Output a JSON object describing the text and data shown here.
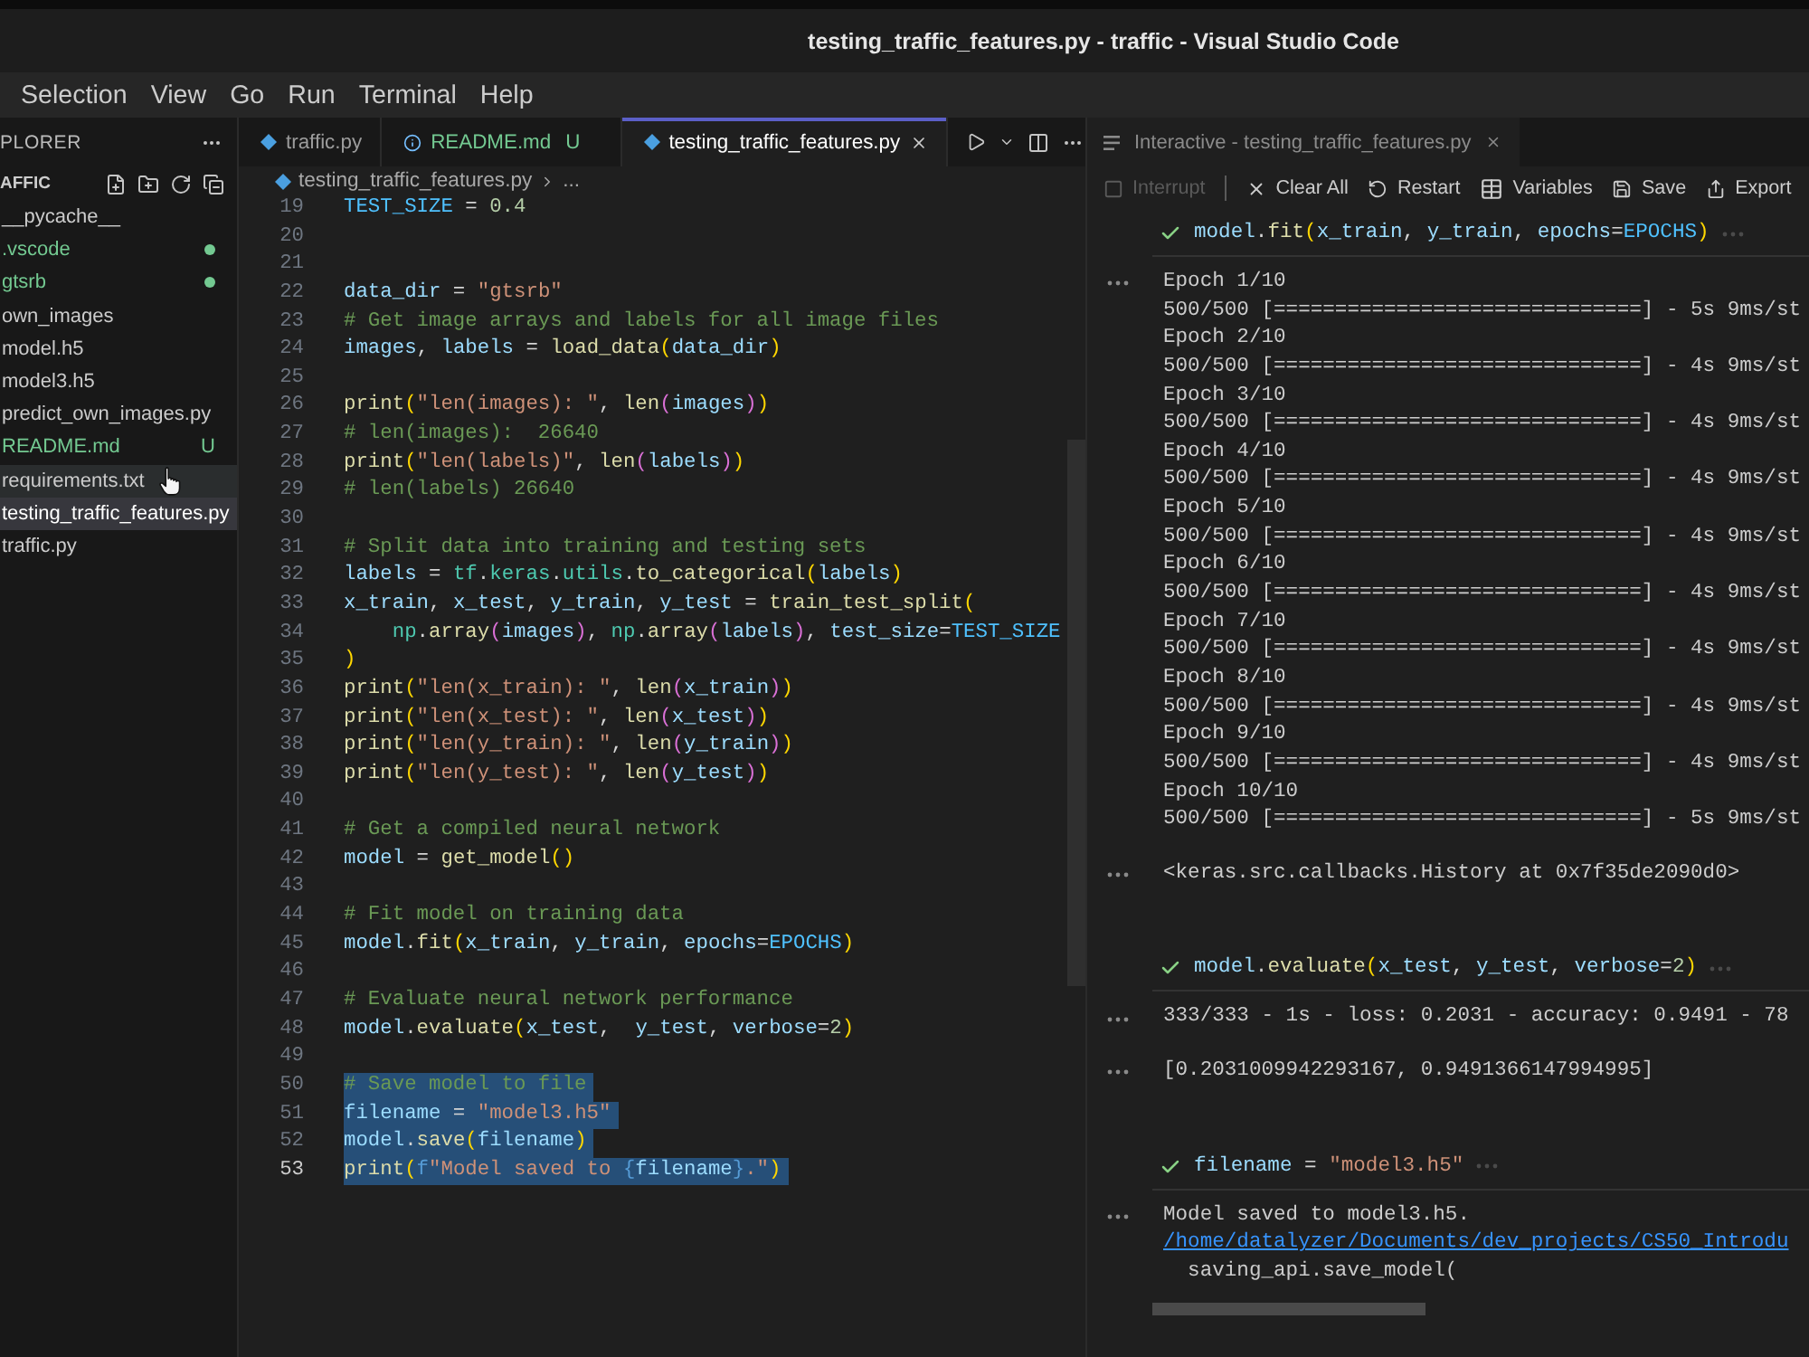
{
  "window": {
    "title": "testing_traffic_features.py - traffic - Visual Studio Code"
  },
  "menu": [
    "Selection",
    "View",
    "Go",
    "Run",
    "Terminal",
    "Help"
  ],
  "sidebar": {
    "title": "PLORER",
    "folder": "AFFIC",
    "files": [
      {
        "name": "__pycache__",
        "untracked": false,
        "selected": false,
        "hovered": false
      },
      {
        "name": ".vscode",
        "untracked": true,
        "selected": false,
        "hovered": false,
        "decoration": {
          "kind": "dot"
        }
      },
      {
        "name": "gtsrb",
        "untracked": true,
        "selected": false,
        "hovered": false,
        "decoration": {
          "kind": "dot"
        }
      },
      {
        "name": "own_images",
        "untracked": false,
        "selected": false,
        "hovered": false
      },
      {
        "name": "model.h5",
        "untracked": false,
        "selected": false,
        "hovered": false
      },
      {
        "name": "model3.h5",
        "untracked": false,
        "selected": false,
        "hovered": false
      },
      {
        "name": "predict_own_images.py",
        "untracked": false,
        "selected": false,
        "hovered": false
      },
      {
        "name": "README.md",
        "untracked": true,
        "selected": false,
        "hovered": false,
        "decoration": {
          "kind": "letter",
          "text": "U"
        }
      },
      {
        "name": "requirements.txt",
        "untracked": false,
        "selected": false,
        "hovered": true
      },
      {
        "name": "testing_traffic_features.py",
        "untracked": false,
        "selected": true,
        "hovered": false
      },
      {
        "name": "traffic.py",
        "untracked": false,
        "selected": false,
        "hovered": false
      }
    ]
  },
  "editor": {
    "tabs": [
      {
        "label": "traffic.py",
        "kind": "python",
        "untracked": false,
        "selected": false
      },
      {
        "label": "README.md",
        "kind": "info",
        "untracked": true,
        "badge": "U",
        "selected": false
      },
      {
        "label": "testing_traffic_features.py",
        "kind": "python",
        "untracked": false,
        "selected": true
      }
    ],
    "breadcrumb": [
      "testing_traffic_features.py",
      "..."
    ],
    "lines": [
      {
        "number": "19",
        "current": false,
        "tokens": [
          {
            "text": "TEST_SIZE",
            "kind": "const"
          },
          {
            "text": " = ",
            "kind": "plain"
          },
          {
            "text": "0.4",
            "kind": "num"
          }
        ]
      },
      {
        "number": "20",
        "current": false
      },
      {
        "number": "21",
        "current": false
      },
      {
        "number": "22",
        "current": false,
        "tokens": [
          {
            "text": "data_dir",
            "kind": "var"
          },
          {
            "text": " = ",
            "kind": "plain"
          },
          {
            "text": "\"gtsrb\"",
            "kind": "str"
          }
        ]
      },
      {
        "number": "23",
        "current": false,
        "tokens": [
          {
            "text": "# Get image arrays and labels for all image files",
            "kind": "comment"
          }
        ]
      },
      {
        "number": "24",
        "current": false,
        "tokens": [
          {
            "text": "images",
            "kind": "var"
          },
          {
            "text": ", ",
            "kind": "plain"
          },
          {
            "text": "labels",
            "kind": "var"
          },
          {
            "text": " = ",
            "kind": "plain"
          },
          {
            "text": "load_data",
            "kind": "func"
          },
          {
            "text": "(",
            "kind": "bracket1"
          },
          {
            "text": "data_dir",
            "kind": "var"
          },
          {
            "text": ")",
            "kind": "bracket1"
          }
        ]
      },
      {
        "number": "25",
        "current": false
      },
      {
        "number": "26",
        "current": false,
        "tokens": [
          {
            "text": "print",
            "kind": "func"
          },
          {
            "text": "(",
            "kind": "bracket1"
          },
          {
            "text": "\"len(images): \"",
            "kind": "str"
          },
          {
            "text": ", ",
            "kind": "plain"
          },
          {
            "text": "len",
            "kind": "func"
          },
          {
            "text": "(",
            "kind": "bracket2"
          },
          {
            "text": "images",
            "kind": "var"
          },
          {
            "text": ")",
            "kind": "bracket2"
          },
          {
            "text": ")",
            "kind": "bracket1"
          }
        ]
      },
      {
        "number": "27",
        "current": false,
        "tokens": [
          {
            "text": "# len(images):  26640",
            "kind": "comment"
          }
        ]
      },
      {
        "number": "28",
        "current": false,
        "tokens": [
          {
            "text": "print",
            "kind": "func"
          },
          {
            "text": "(",
            "kind": "bracket1"
          },
          {
            "text": "\"len(labels)\"",
            "kind": "str"
          },
          {
            "text": ", ",
            "kind": "plain"
          },
          {
            "text": "len",
            "kind": "func"
          },
          {
            "text": "(",
            "kind": "bracket2"
          },
          {
            "text": "labels",
            "kind": "var"
          },
          {
            "text": ")",
            "kind": "bracket2"
          },
          {
            "text": ")",
            "kind": "bracket1"
          }
        ]
      },
      {
        "number": "29",
        "current": false,
        "tokens": [
          {
            "text": "# len(labels) 26640",
            "kind": "comment"
          }
        ]
      },
      {
        "number": "30",
        "current": false
      },
      {
        "number": "31",
        "current": false,
        "tokens": [
          {
            "text": "# Split data into training and testing sets",
            "kind": "comment"
          }
        ]
      },
      {
        "number": "32",
        "current": false,
        "tokens": [
          {
            "text": "labels",
            "kind": "var"
          },
          {
            "text": " = ",
            "kind": "plain"
          },
          {
            "text": "tf",
            "kind": "module"
          },
          {
            "text": ".",
            "kind": "plain"
          },
          {
            "text": "keras",
            "kind": "module"
          },
          {
            "text": ".",
            "kind": "plain"
          },
          {
            "text": "utils",
            "kind": "module"
          },
          {
            "text": ".",
            "kind": "plain"
          },
          {
            "text": "to_categorical",
            "kind": "func"
          },
          {
            "text": "(",
            "kind": "bracket1"
          },
          {
            "text": "labels",
            "kind": "var"
          },
          {
            "text": ")",
            "kind": "bracket1"
          }
        ]
      },
      {
        "number": "33",
        "current": false,
        "tokens": [
          {
            "text": "x_train",
            "kind": "var"
          },
          {
            "text": ", ",
            "kind": "plain"
          },
          {
            "text": "x_test",
            "kind": "var"
          },
          {
            "text": ", ",
            "kind": "plain"
          },
          {
            "text": "y_train",
            "kind": "var"
          },
          {
            "text": ", ",
            "kind": "plain"
          },
          {
            "text": "y_test",
            "kind": "var"
          },
          {
            "text": " = ",
            "kind": "plain"
          },
          {
            "text": "train_test_split",
            "kind": "func"
          },
          {
            "text": "(",
            "kind": "bracket1"
          }
        ]
      },
      {
        "number": "34",
        "current": false,
        "tokens": [
          {
            "text": "    np",
            "kind": "module"
          },
          {
            "text": ".",
            "kind": "plain"
          },
          {
            "text": "array",
            "kind": "func"
          },
          {
            "text": "(",
            "kind": "bracket2"
          },
          {
            "text": "images",
            "kind": "var"
          },
          {
            "text": ")",
            "kind": "bracket2"
          },
          {
            "text": ", ",
            "kind": "plain"
          },
          {
            "text": "np",
            "kind": "module"
          },
          {
            "text": ".",
            "kind": "plain"
          },
          {
            "text": "array",
            "kind": "func"
          },
          {
            "text": "(",
            "kind": "bracket2"
          },
          {
            "text": "labels",
            "kind": "var"
          },
          {
            "text": ")",
            "kind": "bracket2"
          },
          {
            "text": ", ",
            "kind": "plain"
          },
          {
            "text": "test_size",
            "kind": "var"
          },
          {
            "text": "=",
            "kind": "plain"
          },
          {
            "text": "TEST_SIZE",
            "kind": "const"
          }
        ]
      },
      {
        "number": "35",
        "current": false,
        "tokens": [
          {
            "text": ")",
            "kind": "bracket1"
          }
        ]
      },
      {
        "number": "36",
        "current": false,
        "tokens": [
          {
            "text": "print",
            "kind": "func"
          },
          {
            "text": "(",
            "kind": "bracket1"
          },
          {
            "text": "\"len(x_train): \"",
            "kind": "str"
          },
          {
            "text": ", ",
            "kind": "plain"
          },
          {
            "text": "len",
            "kind": "func"
          },
          {
            "text": "(",
            "kind": "bracket2"
          },
          {
            "text": "x_train",
            "kind": "var"
          },
          {
            "text": ")",
            "kind": "bracket2"
          },
          {
            "text": ")",
            "kind": "bracket1"
          }
        ]
      },
      {
        "number": "37",
        "current": false,
        "tokens": [
          {
            "text": "print",
            "kind": "func"
          },
          {
            "text": "(",
            "kind": "bracket1"
          },
          {
            "text": "\"len(x_test): \"",
            "kind": "str"
          },
          {
            "text": ", ",
            "kind": "plain"
          },
          {
            "text": "len",
            "kind": "func"
          },
          {
            "text": "(",
            "kind": "bracket2"
          },
          {
            "text": "x_test",
            "kind": "var"
          },
          {
            "text": ")",
            "kind": "bracket2"
          },
          {
            "text": ")",
            "kind": "bracket1"
          }
        ]
      },
      {
        "number": "38",
        "current": false,
        "tokens": [
          {
            "text": "print",
            "kind": "func"
          },
          {
            "text": "(",
            "kind": "bracket1"
          },
          {
            "text": "\"len(y_train): \"",
            "kind": "str"
          },
          {
            "text": ", ",
            "kind": "plain"
          },
          {
            "text": "len",
            "kind": "func"
          },
          {
            "text": "(",
            "kind": "bracket2"
          },
          {
            "text": "y_train",
            "kind": "var"
          },
          {
            "text": ")",
            "kind": "bracket2"
          },
          {
            "text": ")",
            "kind": "bracket1"
          }
        ]
      },
      {
        "number": "39",
        "current": false,
        "tokens": [
          {
            "text": "print",
            "kind": "func"
          },
          {
            "text": "(",
            "kind": "bracket1"
          },
          {
            "text": "\"len(y_test): \"",
            "kind": "str"
          },
          {
            "text": ", ",
            "kind": "plain"
          },
          {
            "text": "len",
            "kind": "func"
          },
          {
            "text": "(",
            "kind": "bracket2"
          },
          {
            "text": "y_test",
            "kind": "var"
          },
          {
            "text": ")",
            "kind": "bracket2"
          },
          {
            "text": ")",
            "kind": "bracket1"
          }
        ]
      },
      {
        "number": "40",
        "current": false
      },
      {
        "number": "41",
        "current": false,
        "tokens": [
          {
            "text": "# Get a compiled neural network",
            "kind": "comment"
          }
        ]
      },
      {
        "number": "42",
        "current": false,
        "tokens": [
          {
            "text": "model",
            "kind": "var"
          },
          {
            "text": " = ",
            "kind": "plain"
          },
          {
            "text": "get_model",
            "kind": "func"
          },
          {
            "text": "()",
            "kind": "bracket1"
          }
        ]
      },
      {
        "number": "43",
        "current": false
      },
      {
        "number": "44",
        "current": false,
        "tokens": [
          {
            "text": "# Fit model on training data",
            "kind": "comment"
          }
        ]
      },
      {
        "number": "45",
        "current": false,
        "tokens": [
          {
            "text": "model",
            "kind": "var"
          },
          {
            "text": ".",
            "kind": "plain"
          },
          {
            "text": "fit",
            "kind": "func"
          },
          {
            "text": "(",
            "kind": "bracket1"
          },
          {
            "text": "x_train",
            "kind": "var"
          },
          {
            "text": ", ",
            "kind": "plain"
          },
          {
            "text": "y_train",
            "kind": "var"
          },
          {
            "text": ", ",
            "kind": "plain"
          },
          {
            "text": "epochs",
            "kind": "var"
          },
          {
            "text": "=",
            "kind": "plain"
          },
          {
            "text": "EPOCHS",
            "kind": "const"
          },
          {
            "text": ")",
            "kind": "bracket1"
          }
        ]
      },
      {
        "number": "46",
        "current": false
      },
      {
        "number": "47",
        "current": false,
        "tokens": [
          {
            "text": "# Evaluate neural network performance",
            "kind": "comment"
          }
        ]
      },
      {
        "number": "48",
        "current": false,
        "tokens": [
          {
            "text": "model",
            "kind": "var"
          },
          {
            "text": ".",
            "kind": "plain"
          },
          {
            "text": "evaluate",
            "kind": "func"
          },
          {
            "text": "(",
            "kind": "bracket1"
          },
          {
            "text": "x_test",
            "kind": "var"
          },
          {
            "text": ",  ",
            "kind": "plain"
          },
          {
            "text": "y_test",
            "kind": "var"
          },
          {
            "text": ", ",
            "kind": "plain"
          },
          {
            "text": "verbose",
            "kind": "var"
          },
          {
            "text": "=",
            "kind": "plain"
          },
          {
            "text": "2",
            "kind": "num"
          },
          {
            "text": ")",
            "kind": "bracket1"
          }
        ]
      },
      {
        "number": "49",
        "current": false
      },
      {
        "number": "50",
        "selected": true,
        "current": false,
        "tokens": [
          {
            "text": "# Save model to file",
            "kind": "comment"
          }
        ]
      },
      {
        "number": "51",
        "selected": true,
        "current": false,
        "tokens": [
          {
            "text": "filename",
            "kind": "var"
          },
          {
            "text": " = ",
            "kind": "plain"
          },
          {
            "text": "\"model3.h5\"",
            "kind": "str"
          }
        ]
      },
      {
        "number": "52",
        "selected": true,
        "current": false,
        "tokens": [
          {
            "text": "model",
            "kind": "var"
          },
          {
            "text": ".",
            "kind": "plain"
          },
          {
            "text": "save",
            "kind": "func"
          },
          {
            "text": "(",
            "kind": "bracket1"
          },
          {
            "text": "filename",
            "kind": "var"
          },
          {
            "text": ")",
            "kind": "bracket1"
          }
        ]
      },
      {
        "number": "53",
        "selected": true,
        "current": true,
        "tokens": [
          {
            "text": "print",
            "kind": "func"
          },
          {
            "text": "(",
            "kind": "bracket1"
          },
          {
            "text": "f",
            "kind": "keyword"
          },
          {
            "text": "\"Model saved to ",
            "kind": "str"
          },
          {
            "text": "{",
            "kind": "keyword"
          },
          {
            "text": "filename",
            "kind": "var"
          },
          {
            "text": "}",
            "kind": "keyword"
          },
          {
            "text": ".\"",
            "kind": "str"
          },
          {
            "text": ")",
            "kind": "bracket1"
          }
        ]
      }
    ]
  },
  "interactive": {
    "tab": {
      "title": "Interactive - testing_traffic_features.py"
    },
    "toolbar": [
      {
        "kind": "interrupt",
        "label": "Interrupt",
        "disabled": true
      },
      {
        "kind": "separator"
      },
      {
        "kind": "clear",
        "label": "Clear All",
        "disabled": false
      },
      {
        "kind": "restart",
        "label": "Restart",
        "disabled": false
      },
      {
        "kind": "variables",
        "label": "Variables",
        "disabled": false
      },
      {
        "kind": "save",
        "label": "Save",
        "disabled": false
      },
      {
        "kind": "export",
        "label": "Export",
        "disabled": false
      }
    ],
    "cells": [
      {
        "succeeded": true,
        "code": [
          {
            "text": "model",
            "kind": "var"
          },
          {
            "text": ".",
            "kind": "plain"
          },
          {
            "text": "fit",
            "kind": "func"
          },
          {
            "text": "(",
            "kind": "bracket1"
          },
          {
            "text": "x_train",
            "kind": "var"
          },
          {
            "text": ", ",
            "kind": "plain"
          },
          {
            "text": "y_train",
            "kind": "var"
          },
          {
            "text": ", ",
            "kind": "plain"
          },
          {
            "text": "epochs",
            "kind": "var"
          },
          {
            "text": "=",
            "kind": "plain"
          },
          {
            "text": "EPOCHS",
            "kind": "const"
          },
          {
            "text": ")",
            "kind": "bracket1"
          }
        ],
        "outputs": [
          {
            "lines": [
              {
                "text": "Epoch 1/10",
                "kind": "text"
              },
              {
                "text": "500/500 [==============================] - 5s 9ms/st",
                "kind": "text"
              },
              {
                "text": "Epoch 2/10",
                "kind": "text"
              },
              {
                "text": "500/500 [==============================] - 4s 9ms/st",
                "kind": "text"
              },
              {
                "text": "Epoch 3/10",
                "kind": "text"
              },
              {
                "text": "500/500 [==============================] - 4s 9ms/st",
                "kind": "text"
              },
              {
                "text": "Epoch 4/10",
                "kind": "text"
              },
              {
                "text": "500/500 [==============================] - 4s 9ms/st",
                "kind": "text"
              },
              {
                "text": "Epoch 5/10",
                "kind": "text"
              },
              {
                "text": "500/500 [==============================] - 4s 9ms/st",
                "kind": "text"
              },
              {
                "text": "Epoch 6/10",
                "kind": "text"
              },
              {
                "text": "500/500 [==============================] - 4s 9ms/st",
                "kind": "text"
              },
              {
                "text": "Epoch 7/10",
                "kind": "text"
              },
              {
                "text": "500/500 [==============================] - 4s 9ms/st",
                "kind": "text"
              },
              {
                "text": "Epoch 8/10",
                "kind": "text"
              },
              {
                "text": "500/500 [==============================] - 4s 9ms/st",
                "kind": "text"
              },
              {
                "text": "Epoch 9/10",
                "kind": "text"
              },
              {
                "text": "500/500 [==============================] - 4s 9ms/st",
                "kind": "text"
              },
              {
                "text": "Epoch 10/10",
                "kind": "text"
              },
              {
                "text": "500/500 [==============================] - 5s 9ms/st",
                "kind": "text"
              }
            ]
          },
          {
            "lines": [
              {
                "text": "<keras.src.callbacks.History at 0x7f35de2090d0>",
                "kind": "text"
              }
            ]
          }
        ]
      },
      {
        "succeeded": true,
        "code": [
          {
            "text": "model",
            "kind": "var"
          },
          {
            "text": ".",
            "kind": "plain"
          },
          {
            "text": "evaluate",
            "kind": "func"
          },
          {
            "text": "(",
            "kind": "bracket1"
          },
          {
            "text": "x_test",
            "kind": "var"
          },
          {
            "text": ", ",
            "kind": "plain"
          },
          {
            "text": "y_test",
            "kind": "var"
          },
          {
            "text": ", ",
            "kind": "plain"
          },
          {
            "text": "verbose",
            "kind": "var"
          },
          {
            "text": "=",
            "kind": "plain"
          },
          {
            "text": "2",
            "kind": "num"
          },
          {
            "text": ")",
            "kind": "bracket1"
          }
        ],
        "outputs": [
          {
            "lines": [
              {
                "text": "333/333 - 1s - loss: 0.2031 - accuracy: 0.9491 - 78",
                "kind": "text"
              }
            ]
          },
          {
            "lines": [
              {
                "text": "[0.2031009942293167, 0.9491366147994995]",
                "kind": "text"
              }
            ]
          }
        ]
      },
      {
        "succeeded": true,
        "code": [
          {
            "text": "filename",
            "kind": "var"
          },
          {
            "text": " = ",
            "kind": "plain"
          },
          {
            "text": "\"model3.h5\"",
            "kind": "str"
          }
        ],
        "outputs": [
          {
            "lines": [
              {
                "text": "Model saved to model3.h5.",
                "kind": "text"
              },
              {
                "text": "/home/datalyzer/Documents/dev_projects/CS50_Introdu",
                "kind": "link"
              },
              {
                "text": "  saving_api.save_model(",
                "kind": "text"
              }
            ]
          }
        ]
      }
    ]
  }
}
